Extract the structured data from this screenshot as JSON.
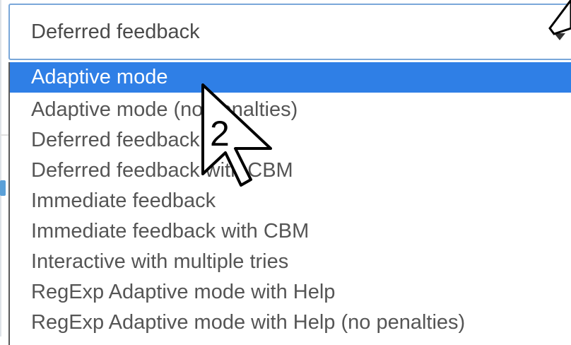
{
  "select": {
    "value": "Deferred feedback"
  },
  "dropdown": {
    "options": [
      "Adaptive mode",
      "Adaptive mode (no penalties)",
      "Deferred feedback",
      "Deferred feedback with CBM",
      "Immediate feedback",
      "Immediate feedback with CBM",
      "Interactive with multiple tries",
      "RegExp Adaptive mode with Help",
      "RegExp Adaptive mode with Help (no penalties)"
    ],
    "selected_index": 0
  },
  "cursor": {
    "label": "2"
  }
}
